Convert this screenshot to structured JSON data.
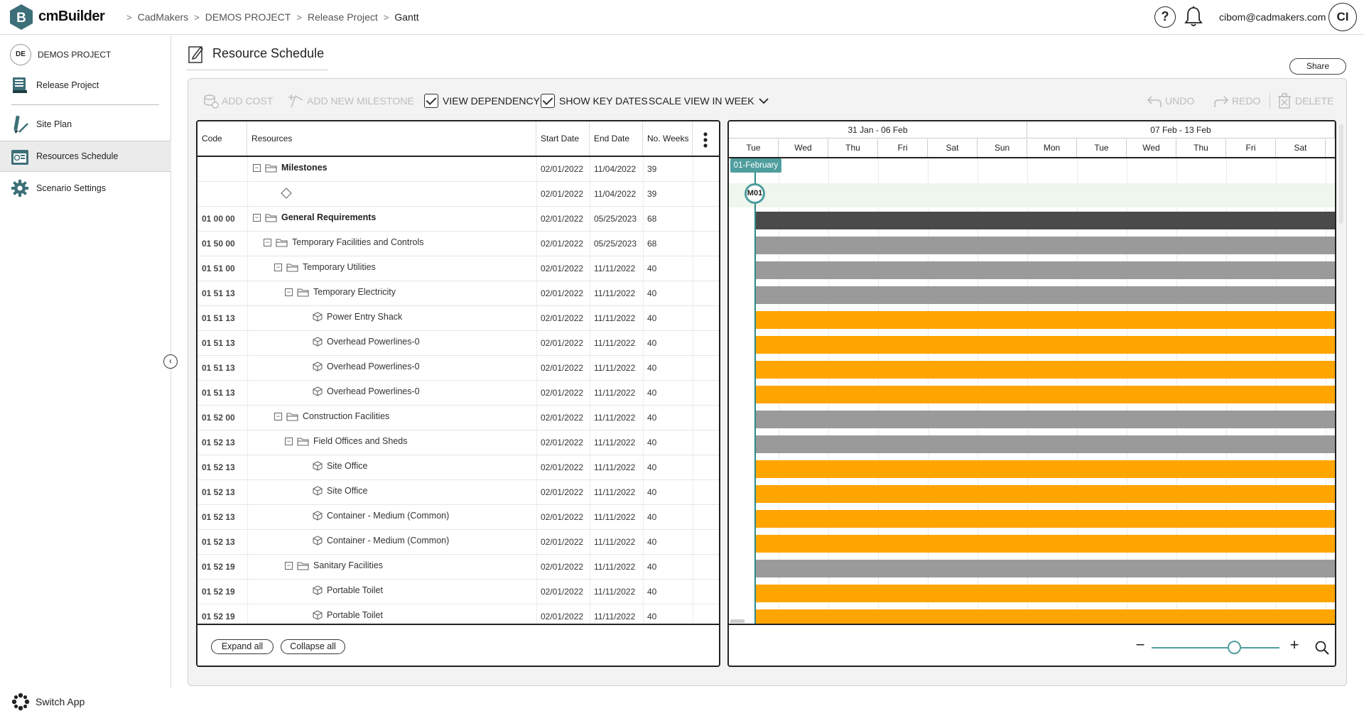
{
  "app": {
    "name": "cmBuilder"
  },
  "breadcrumb": [
    "CadMakers",
    "DEMOS PROJECT",
    "Release Project",
    "Gantt"
  ],
  "user": {
    "email": "cibom@cadmakers.com",
    "initials": "CI"
  },
  "help_label": "?",
  "sidebar": {
    "project_badge": "DE",
    "project_name": "DEMOS PROJECT",
    "items": [
      {
        "label": "Release Project",
        "icon": "book-icon"
      },
      {
        "label": "Site Plan",
        "icon": "pencil-ruler-icon"
      },
      {
        "label": "Resources Schedule",
        "icon": "schedule-icon"
      },
      {
        "label": "Scenario Settings",
        "icon": "gear-icon"
      }
    ],
    "switch_app": "Switch App"
  },
  "page": {
    "title": "Resource Schedule",
    "share": "Share"
  },
  "toolbar": {
    "add_cost": "ADD COST",
    "add_milestone": "ADD NEW MILESTONE",
    "view_dependency": "VIEW DEPENDENCY",
    "show_key_dates": "SHOW KEY DATES",
    "scale_view": "SCALE VIEW IN WEEK",
    "undo": "UNDO",
    "redo": "REDO",
    "delete": "DELETE"
  },
  "grid": {
    "headers": {
      "code": "Code",
      "resources": "Resources",
      "start": "Start Date",
      "end": "End Date",
      "weeks": "No. Weeks"
    },
    "rows": [
      {
        "code": "",
        "name": "Milestones",
        "level": 1,
        "type": "folder",
        "bold": true,
        "start": "02/01/2022",
        "end": "11/04/2022",
        "weeks": "39",
        "bar": "none"
      },
      {
        "code": "",
        "name": "",
        "level": 2,
        "type": "diamond",
        "bold": false,
        "start": "02/01/2022",
        "end": "11/04/2022",
        "weeks": "39",
        "bar": "milestone"
      },
      {
        "code": "01 00 00",
        "name": "General Requirements",
        "level": 1,
        "type": "folder",
        "bold": true,
        "start": "02/01/2022",
        "end": "05/25/2023",
        "weeks": "68",
        "bar": "dark"
      },
      {
        "code": "01 50 00",
        "name": "Temporary Facilities and Controls",
        "level": 2,
        "type": "folder",
        "bold": false,
        "start": "02/01/2022",
        "end": "05/25/2023",
        "weeks": "68",
        "bar": "gray"
      },
      {
        "code": "01 51 00",
        "name": "Temporary Utilities",
        "level": 3,
        "type": "folder",
        "bold": false,
        "start": "02/01/2022",
        "end": "11/11/2022",
        "weeks": "40",
        "bar": "gray"
      },
      {
        "code": "01 51 13",
        "name": "Temporary Electricity",
        "level": 4,
        "type": "folder",
        "bold": false,
        "start": "02/01/2022",
        "end": "11/11/2022",
        "weeks": "40",
        "bar": "gray"
      },
      {
        "code": "01 51 13",
        "name": "Power Entry Shack",
        "level": 5,
        "type": "item",
        "bold": false,
        "start": "02/01/2022",
        "end": "11/11/2022",
        "weeks": "40",
        "bar": "orange"
      },
      {
        "code": "01 51 13",
        "name": "Overhead Powerlines-0",
        "level": 5,
        "type": "item",
        "bold": false,
        "start": "02/01/2022",
        "end": "11/11/2022",
        "weeks": "40",
        "bar": "orange"
      },
      {
        "code": "01 51 13",
        "name": "Overhead Powerlines-0",
        "level": 5,
        "type": "item",
        "bold": false,
        "start": "02/01/2022",
        "end": "11/11/2022",
        "weeks": "40",
        "bar": "orange"
      },
      {
        "code": "01 51 13",
        "name": "Overhead Powerlines-0",
        "level": 5,
        "type": "item",
        "bold": false,
        "start": "02/01/2022",
        "end": "11/11/2022",
        "weeks": "40",
        "bar": "orange"
      },
      {
        "code": "01 52 00",
        "name": "Construction Facilities",
        "level": 3,
        "type": "folder",
        "bold": false,
        "start": "02/01/2022",
        "end": "11/11/2022",
        "weeks": "40",
        "bar": "gray"
      },
      {
        "code": "01 52 13",
        "name": "Field Offices and Sheds",
        "level": 4,
        "type": "folder",
        "bold": false,
        "start": "02/01/2022",
        "end": "11/11/2022",
        "weeks": "40",
        "bar": "gray"
      },
      {
        "code": "01 52 13",
        "name": "Site Office",
        "level": 5,
        "type": "item",
        "bold": false,
        "start": "02/01/2022",
        "end": "11/11/2022",
        "weeks": "40",
        "bar": "orange"
      },
      {
        "code": "01 52 13",
        "name": "Site Office",
        "level": 5,
        "type": "item",
        "bold": false,
        "start": "02/01/2022",
        "end": "11/11/2022",
        "weeks": "40",
        "bar": "orange"
      },
      {
        "code": "01 52 13",
        "name": "Container - Medium (Common)",
        "level": 5,
        "type": "item",
        "bold": false,
        "start": "02/01/2022",
        "end": "11/11/2022",
        "weeks": "40",
        "bar": "orange"
      },
      {
        "code": "01 52 13",
        "name": "Container - Medium (Common)",
        "level": 5,
        "type": "item",
        "bold": false,
        "start": "02/01/2022",
        "end": "11/11/2022",
        "weeks": "40",
        "bar": "orange"
      },
      {
        "code": "01 52 19",
        "name": "Sanitary Facilities",
        "level": 4,
        "type": "folder",
        "bold": false,
        "start": "02/01/2022",
        "end": "11/11/2022",
        "weeks": "40",
        "bar": "gray"
      },
      {
        "code": "01 52 19",
        "name": "Portable Toilet",
        "level": 5,
        "type": "item",
        "bold": false,
        "start": "02/01/2022",
        "end": "11/11/2022",
        "weeks": "40",
        "bar": "orange"
      },
      {
        "code": "01 52 19",
        "name": "Portable Toilet",
        "level": 5,
        "type": "item",
        "bold": false,
        "start": "02/01/2022",
        "end": "11/11/2022",
        "weeks": "40",
        "bar": "orange"
      }
    ],
    "expand_all": "Expand all",
    "collapse_all": "Collapse all"
  },
  "gantt": {
    "weeks": [
      "31 Jan - 06 Feb",
      "07 Feb - 13 Feb"
    ],
    "days": [
      "Tue",
      "Wed",
      "Thu",
      "Fri",
      "Sat",
      "Sun",
      "Mon",
      "Tue",
      "Wed",
      "Thu",
      "Fri",
      "Sat"
    ],
    "today_flag": "01-February",
    "milestone_label": "M01",
    "zoom_level": 0.65,
    "colors": {
      "dark": "#4a4a4a",
      "gray": "#9a9a9a",
      "orange": "#ffa500",
      "accent": "#4f9e9e"
    }
  }
}
